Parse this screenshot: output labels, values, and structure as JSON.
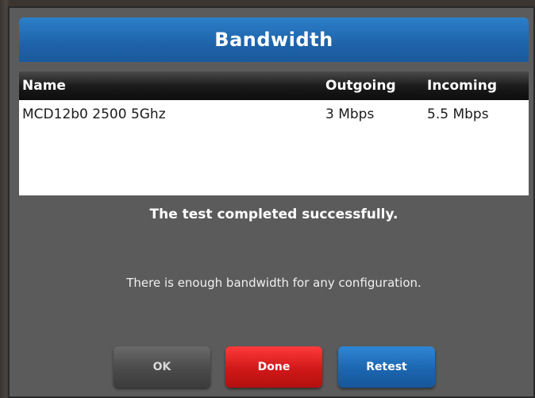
{
  "dialog": {
    "title": "Bandwidth"
  },
  "table": {
    "columns": {
      "name": "Name",
      "outgoing": "Outgoing",
      "incoming": "Incoming"
    },
    "rows": [
      {
        "name": "MCD12b0 2500 5Ghz",
        "outgoing": "3 Mbps",
        "incoming": "5.5 Mbps"
      }
    ]
  },
  "messages": {
    "status": "The test completed successfully.",
    "detail": "There is enough bandwidth for any configuration."
  },
  "buttons": {
    "ok": "OK",
    "done": "Done",
    "retest": "Retest"
  },
  "colors": {
    "title_bar": "#1e63aa",
    "dialog_bg": "#5b5b5b",
    "done_button": "#d01818",
    "retest_button": "#1c66b0",
    "ok_button": "#4a4a4a"
  }
}
